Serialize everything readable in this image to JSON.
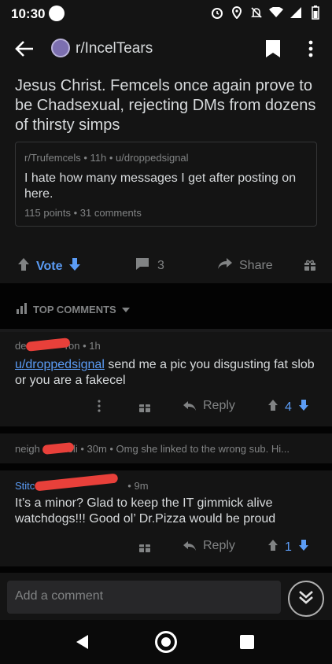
{
  "status": {
    "time": "10:30"
  },
  "header": {
    "subreddit": "r/IncelTears"
  },
  "post": {
    "title": "Jesus Christ. Femcels once again prove to be Chadsexual, rejecting DMs from dozens of thirsty simps",
    "crosspost": {
      "meta": "r/Trufemcels • 11h • u/droppedsignal",
      "text": "I hate how many messages I get after posting on here.",
      "stats": "115 points • 31 comments"
    },
    "actions": {
      "vote": "Vote",
      "comments": "3",
      "share": "Share"
    }
  },
  "sort": {
    "label": "TOP COMMENTS"
  },
  "comments": [
    {
      "meta_prefix": "dee",
      "meta_suffix": "ron • 1h",
      "link": "u/droppedsignal",
      "text": " send me a pic you disgusting fat slob or you are a fakecel",
      "reply": "Reply",
      "score": "4"
    },
    {
      "meta_prefix": "neigh",
      "meta_suffix": "loli • 30m • Omg she linked to the wrong sub.  Hi..."
    },
    {
      "meta_prefix": "Stitc",
      "meta_suffix": "• 9m",
      "text": "It’s a minor? Glad to keep the IT gimmick alive watchdogs!!! Good ol’ Dr.Pizza would be proud",
      "reply": "Reply",
      "score": "1"
    }
  ],
  "composer": {
    "placeholder": "Add a comment"
  },
  "colors": {
    "accent_blue": "#5b9cf5",
    "redaction": "#e8403a",
    "background": "#1a1a1b"
  }
}
